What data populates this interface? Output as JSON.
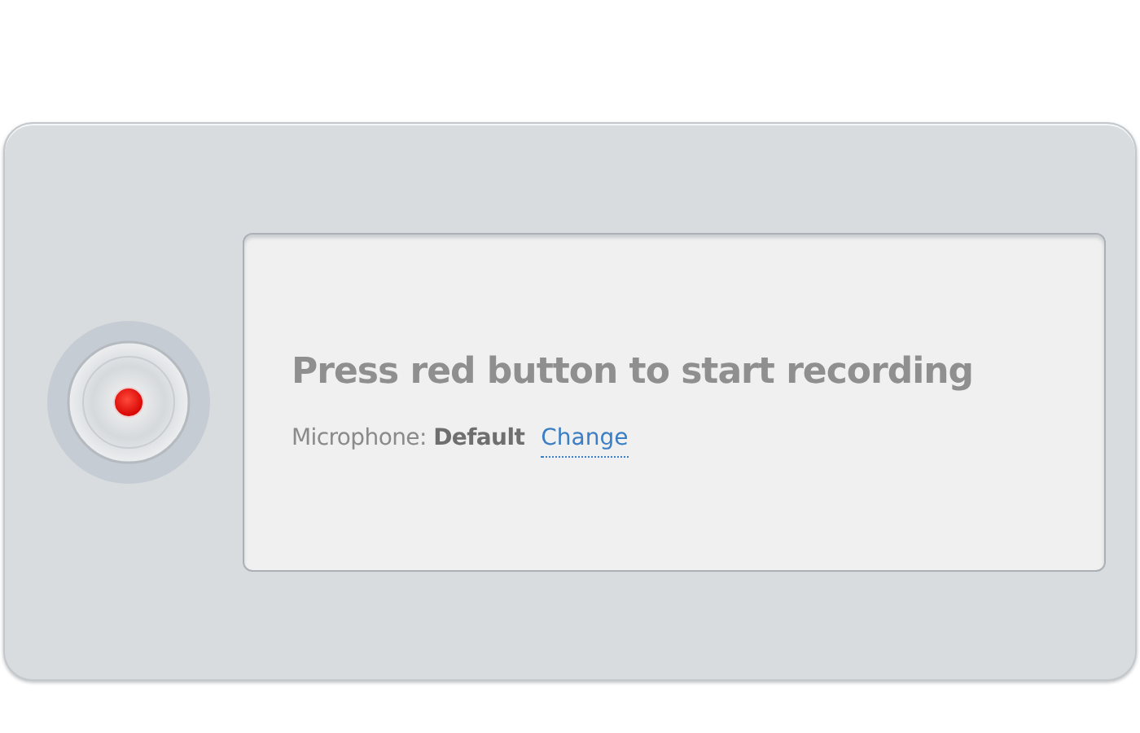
{
  "record_button": {
    "recording": false
  },
  "prompt": "Press red button to start recording",
  "microphone": {
    "label": "Microphone:",
    "value": "Default",
    "link": "Change"
  }
}
